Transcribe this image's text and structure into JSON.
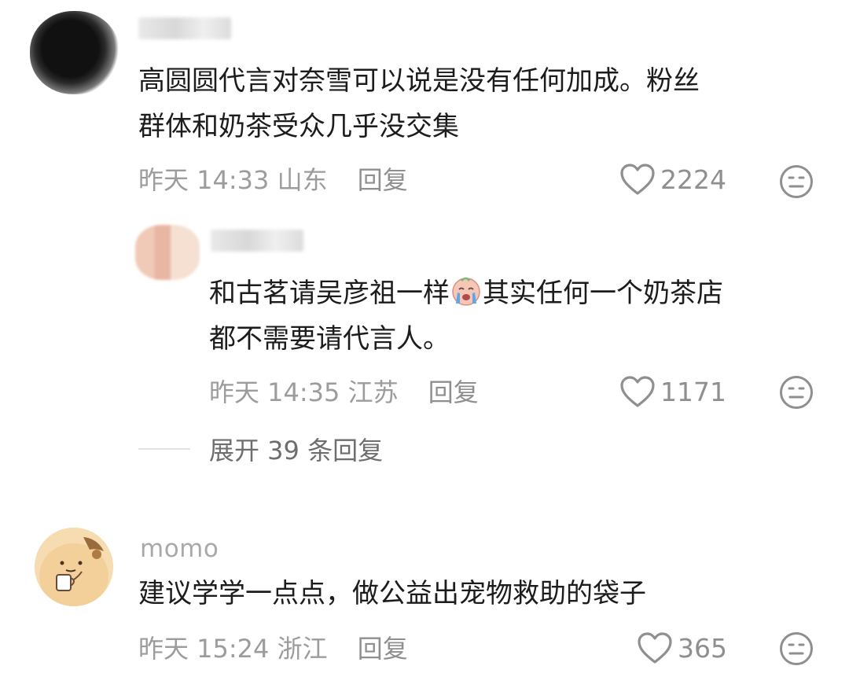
{
  "comments": [
    {
      "username": "",
      "text": "高圆圆代言对奈雪可以说是没有任何加成。粉丝\n群体和奶茶受众几乎没交集",
      "time": "昨天 14:33",
      "location": "山东",
      "reply_label": "回复",
      "likes": "2224"
    },
    {
      "username": "",
      "text_before_emoji": "和古茗请吴彦祖一样",
      "text_after_emoji": "其实任何一个奶茶店\n都不需要请代言人。",
      "time": "昨天 14:35",
      "location": "江苏",
      "reply_label": "回复",
      "likes": "1171",
      "emoji": "crying-face-emoji"
    },
    {
      "username": "momo",
      "text": "建议学学一点点，做公益出宠物救助的袋子",
      "time": "昨天 15:24",
      "location": "浙江",
      "reply_label": "回复",
      "likes": "365"
    }
  ],
  "expand_replies": "展开 39 条回复",
  "icons": {
    "like": "heart-outline-icon",
    "dislike": "neutral-face-icon"
  },
  "colors": {
    "text": "#1c1c1c",
    "meta": "#9c9c9c",
    "username": "#a9a9a9"
  }
}
